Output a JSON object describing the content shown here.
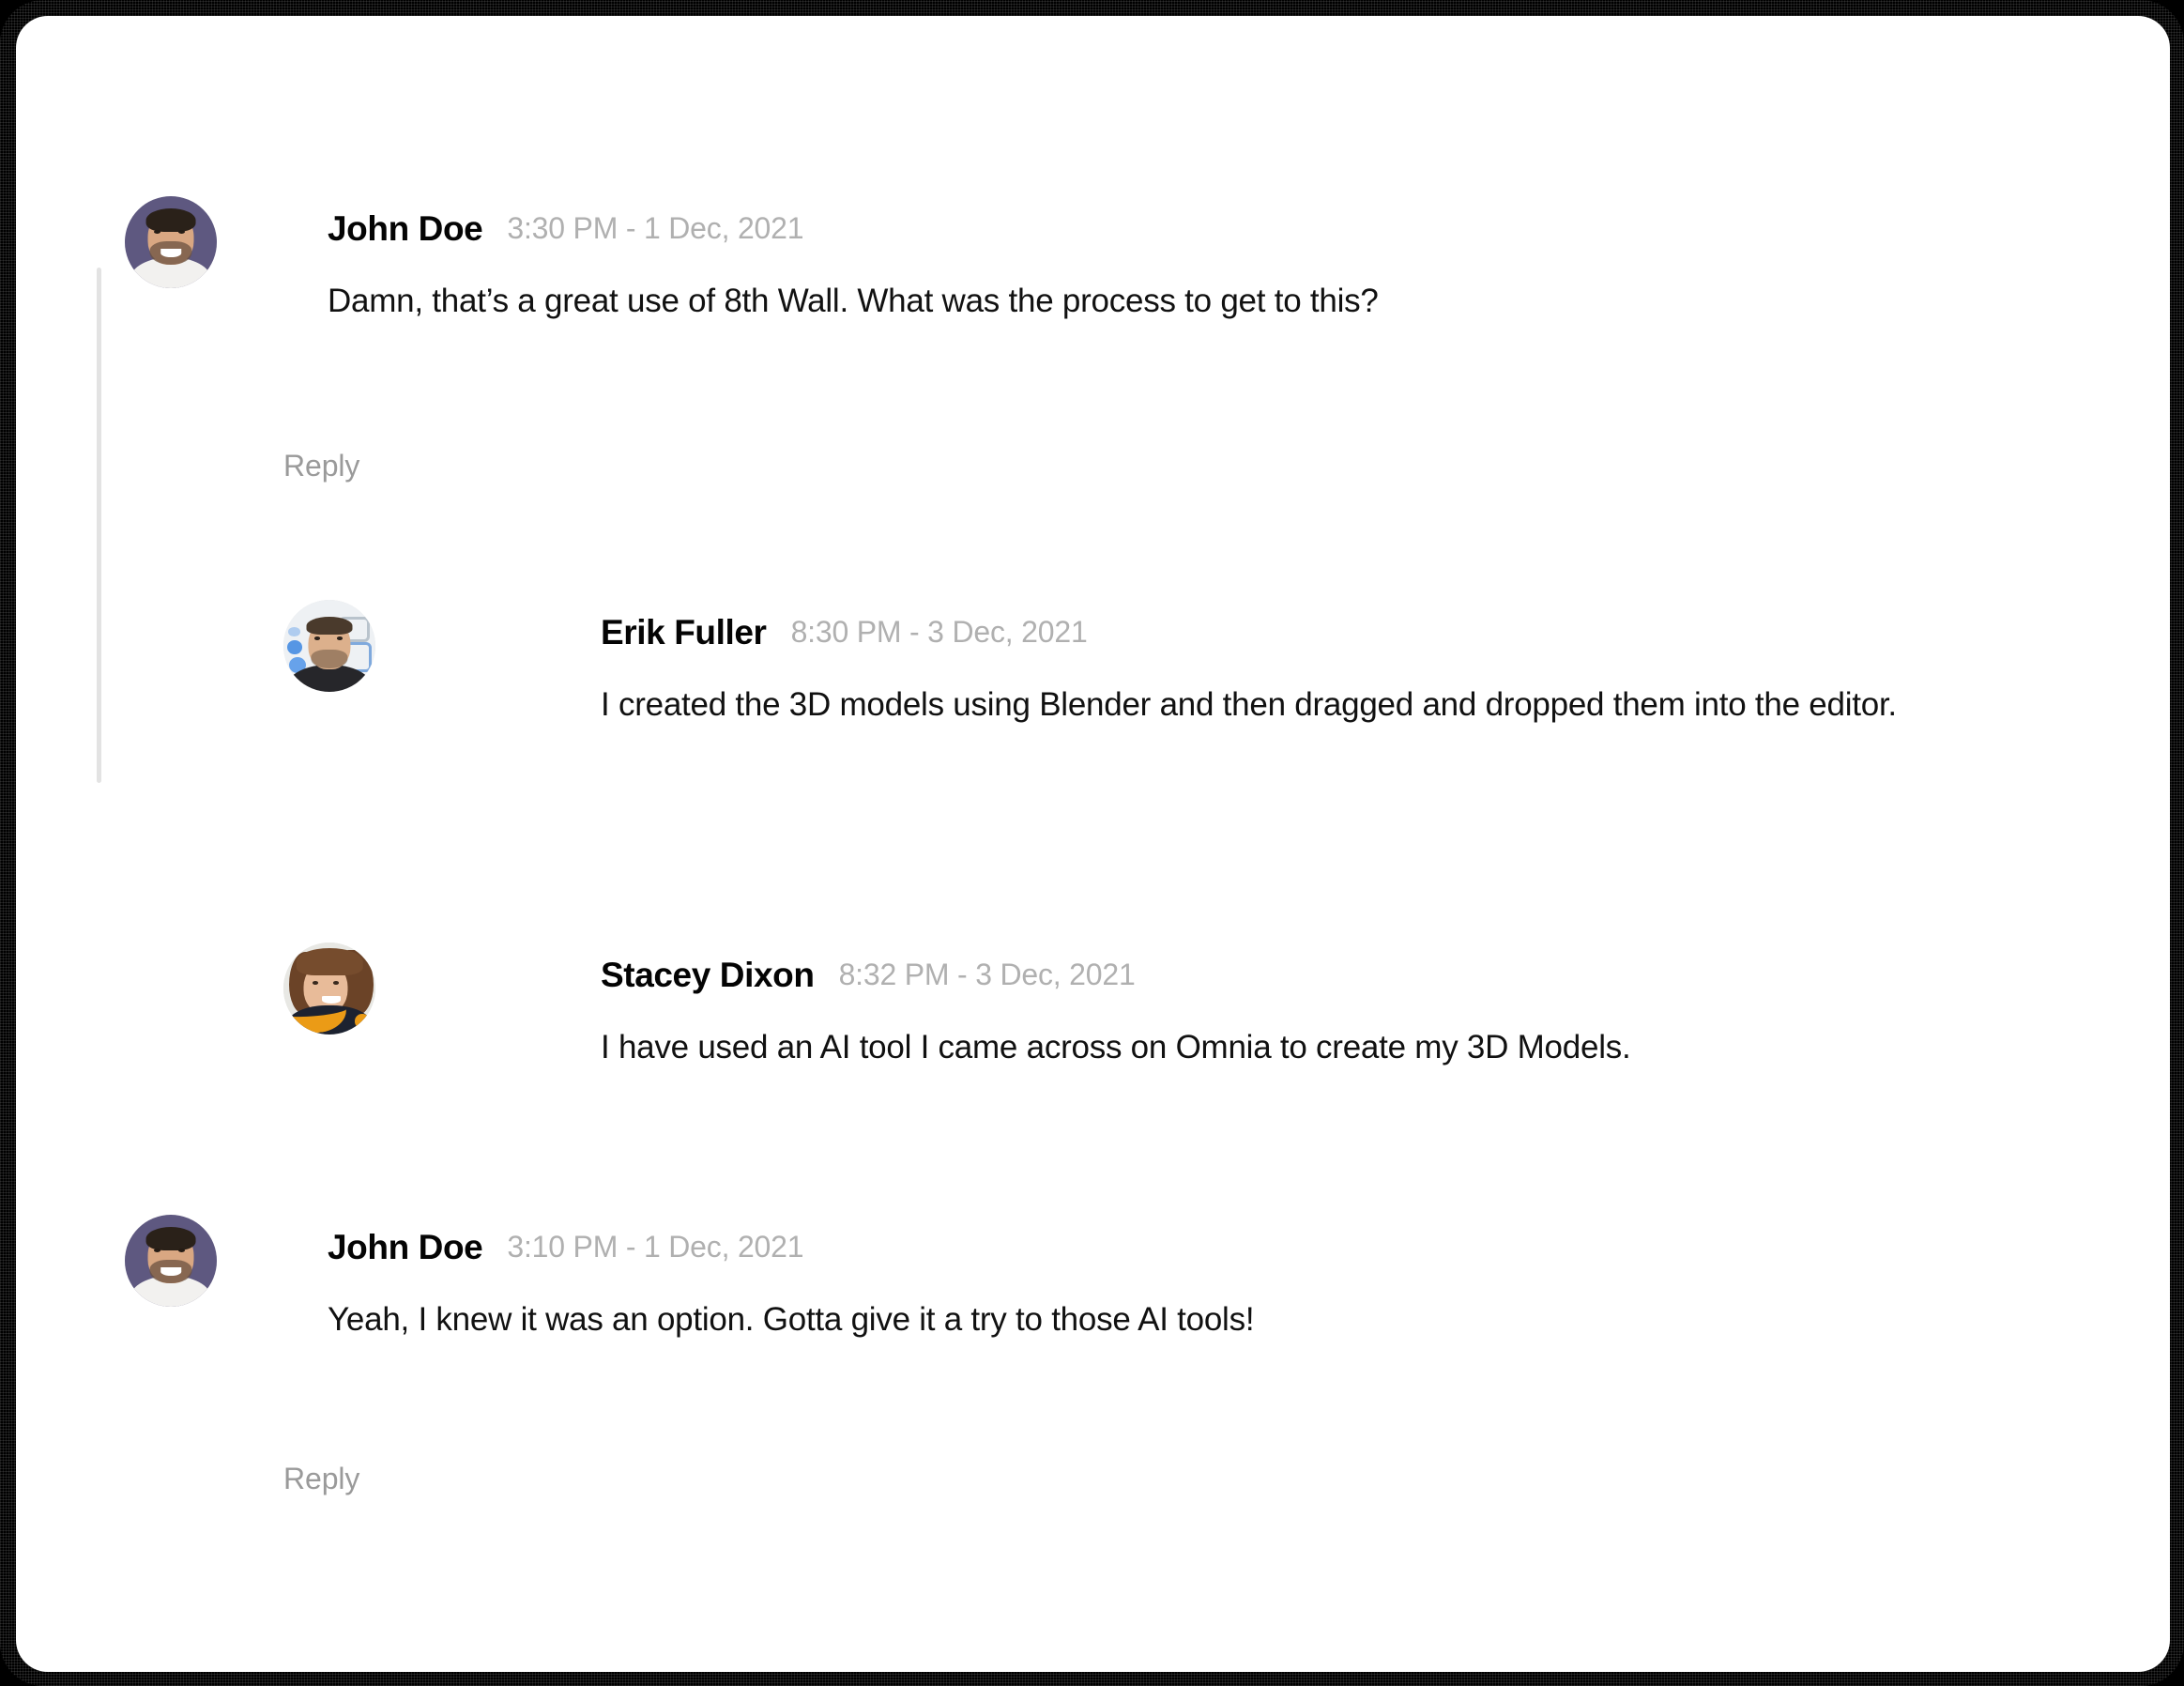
{
  "thread": {
    "comments": [
      {
        "id": "john-doe-1",
        "author": "John Doe",
        "timestamp": "3:30 PM - 1 Dec, 2021",
        "text": "Damn, that’s a great use of 8th Wall. What was the process to get to this?",
        "reply_label": "Reply",
        "avatar_icon": "avatar-john-doe",
        "avatar_bg": "#5e5880",
        "level": "root"
      },
      {
        "id": "erik-fuller-1",
        "author": "Erik Fuller",
        "timestamp": "8:30 PM - 3 Dec, 2021",
        "text": "I created the 3D models using Blender and then dragged and dropped them into the editor.",
        "avatar_icon": "avatar-erik-fuller",
        "avatar_bg": "#eef1f4",
        "level": "nested"
      },
      {
        "id": "stacey-dixon-1",
        "author": "Stacey Dixon",
        "timestamp": "8:32 PM - 3 Dec, 2021",
        "text": "I have used an AI tool I came across on Omnia to create my 3D Models.",
        "avatar_icon": "avatar-stacey-dixon",
        "avatar_bg": "#e8e8e4",
        "level": "nested"
      },
      {
        "id": "john-doe-2",
        "author": "John Doe",
        "timestamp": "3:10 PM - 1 Dec, 2021",
        "text": "Yeah, I knew it was an option. Gotta give it a try to those AI tools!",
        "reply_label": "Reply",
        "avatar_icon": "avatar-john-doe",
        "avatar_bg": "#5e5880",
        "level": "root"
      }
    ]
  },
  "colors": {
    "frame": "#000000",
    "card": "#ffffff",
    "name_text": "#040404",
    "timestamp_text": "#b0b0b0",
    "body_text": "#111111",
    "reply_text": "#9a9a9a",
    "thread_line": "#e3e3e3"
  }
}
